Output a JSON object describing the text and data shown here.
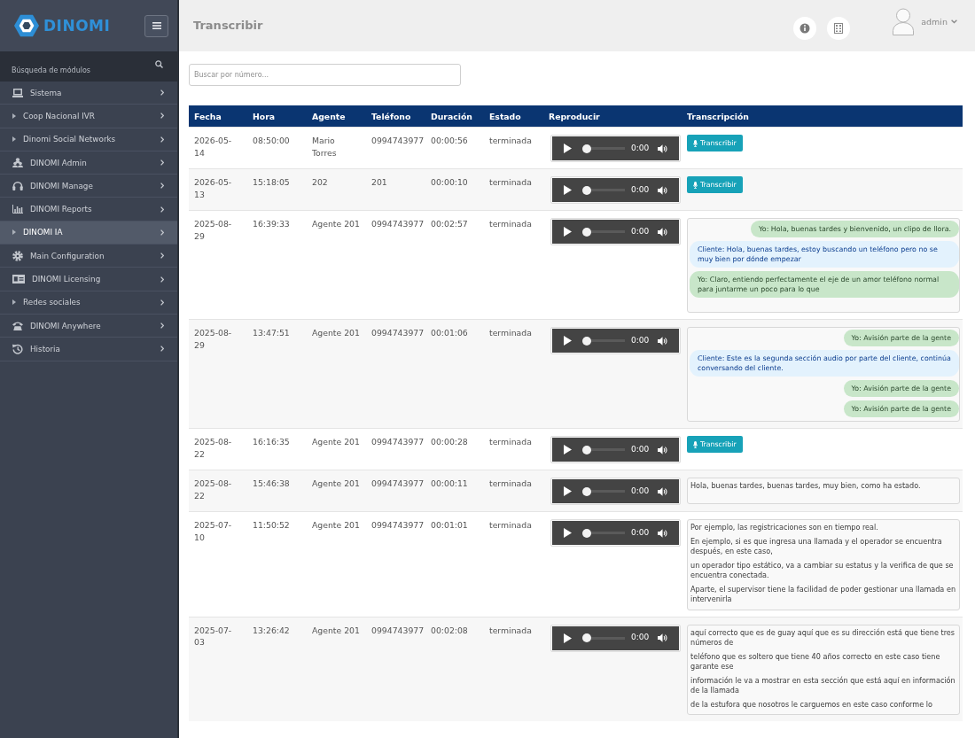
{
  "sidebar": {
    "logo": "DINOMI",
    "search": {
      "placeholder": "Búsqueda de módulos"
    },
    "items": [
      {
        "label": "Sistema",
        "selected": false
      },
      {
        "label": "Coop Nacional IVR",
        "selected": false
      },
      {
        "label": "Dinomi Social Networks",
        "selected": false
      },
      {
        "label": "DINOMI Admin",
        "selected": false
      },
      {
        "label": "DINOMI Manage",
        "selected": false
      },
      {
        "label": "DINOMI Reports",
        "selected": false
      },
      {
        "label": "DINOMI IA",
        "selected": true
      },
      {
        "label": "Main Configuration",
        "selected": false
      },
      {
        "label": "DINOMI Licensing",
        "selected": false
      },
      {
        "label": "Redes sociales",
        "selected": false
      },
      {
        "label": "DINOMI Anywhere",
        "selected": false
      },
      {
        "label": "Historia",
        "selected": false
      }
    ]
  },
  "header": {
    "title": "Transcribir",
    "user": "admin"
  },
  "search": {
    "placeholder": "Buscar por número..."
  },
  "table": {
    "columns": [
      "Fecha",
      "Hora",
      "Agente",
      "Teléfono",
      "Duración",
      "Estado",
      "Reproducir",
      "Transcripción"
    ],
    "rows": [
      {
        "date": "2026-05-14",
        "time": "08:50:00",
        "agent": "Mario Torres",
        "phone": "0994743977",
        "duration": "00:00:56",
        "status": "terminada",
        "player": {
          "time": "0:00",
          "level": 0
        },
        "transcription": {
          "kind": "button",
          "label": "Transcribir"
        }
      },
      {
        "date": "2026-05-13",
        "time": "15:18:05",
        "agent": "202",
        "phone": "201",
        "duration": "00:00:10",
        "status": "terminada",
        "player": {
          "time": "0:00",
          "level": 0
        },
        "transcription": {
          "kind": "button",
          "label": "Transcribir"
        }
      },
      {
        "date": "2025-08-29",
        "time": "16:39:33",
        "agent": "Agente 201",
        "phone": "0994743977",
        "duration": "00:02:57",
        "status": "terminada",
        "player": {
          "time": "0:00",
          "level": 0
        },
        "transcription": {
          "kind": "chat",
          "messages": [
            {
              "kind": "agent",
              "text": "Yo: Hola, buenas tardes y bienvenido, un clipo de llora."
            },
            {
              "kind": "client",
              "text": "Cliente: Hola, buenas tardes, estoy buscando un teléfono pero no se muy bien por dónde empezar"
            },
            {
              "kind": "agent",
              "text": "Yo: Claro, entiendo perfectamente el eje de un amor teléfono normal para juntarme un poco para lo que"
            }
          ]
        }
      },
      {
        "date": "2025-08-29",
        "time": "13:47:51",
        "agent": "Agente 201",
        "phone": "0994743977",
        "duration": "00:01:06",
        "status": "terminada",
        "player": {
          "time": "0:00",
          "level": 0
        },
        "transcription": {
          "kind": "chat",
          "messages": [
            {
              "kind": "agent",
              "text": "Yo: Avisión parte de la gente"
            },
            {
              "kind": "client",
              "text": "Cliente: Este es la segunda sección audio por parte del cliente, continúa conversando del cliente."
            },
            {
              "kind": "agent",
              "text": "Yo: Avisión parte de la gente"
            },
            {
              "kind": "agent",
              "text": "Yo: Avisión parte de la gente"
            }
          ]
        }
      },
      {
        "date": "2025-08-22",
        "time": "16:16:35",
        "agent": "Agente 201",
        "phone": "0994743977",
        "duration": "00:00:28",
        "status": "terminada",
        "player": {
          "time": "0:00",
          "level": 0
        },
        "transcription": {
          "kind": "button",
          "label": "Transcribir"
        }
      },
      {
        "date": "2025-08-22",
        "time": "15:46:38",
        "agent": "Agente 201",
        "phone": "0994743977",
        "duration": "00:00:11",
        "status": "terminada",
        "player": {
          "time": "0:00",
          "level": 0
        },
        "transcription": {
          "kind": "text",
          "paragraphs": [
            "Hola, buenas tardes, buenas tardes, muy bien, como ha estado."
          ]
        }
      },
      {
        "date": "2025-07-10",
        "time": "11:50:52",
        "agent": "Agente 201",
        "phone": "0994743977",
        "duration": "00:01:01",
        "status": "terminada",
        "player": {
          "time": "0:00",
          "level": 0
        },
        "transcription": {
          "kind": "text",
          "paragraphs": [
            "Por ejemplo, las registricaciones son en tiempo real.",
            "En ejemplo, si es que ingresa una llamada y el operador se encuentra después, en este caso,",
            "un operador tipo estático, va a cambiar su estatus y la verifica de que se encuentra conectada.",
            "Aparte, el supervisor tiene la facilidad de poder gestionar una llamada en intervenirla"
          ]
        }
      },
      {
        "date": "2025-07-03",
        "time": "13:26:42",
        "agent": "Agente 201",
        "phone": "0994743977",
        "duration": "00:02:08",
        "status": "terminada",
        "player": {
          "time": "0:00",
          "level": 0
        },
        "transcription": {
          "kind": "text",
          "paragraphs": [
            "aquí correcto que es de guay aquí que es su dirección está que tiene tres números de",
            "teléfono que es soltero que tiene 40 años correcto en este caso tiene garante ese",
            "información le va a mostrar en esta sección que está aquí en información de la llamada",
            "de la estufora que nosotros le carguemos en este caso conforme lo"
          ]
        }
      }
    ]
  }
}
